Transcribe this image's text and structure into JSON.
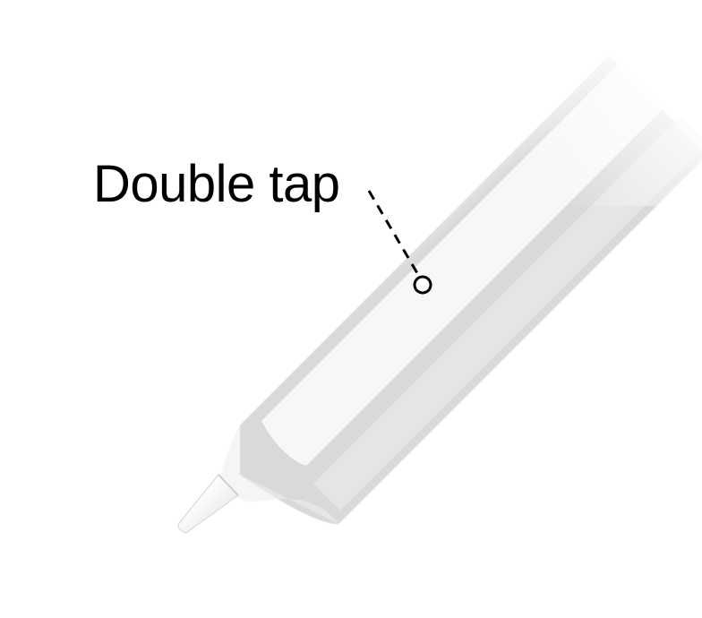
{
  "callout": {
    "label": "Double tap"
  },
  "colors": {
    "background": "#ffffff",
    "pencil_body": "#f2f2f2",
    "pencil_shadow": "#dcdcdc",
    "callout_line": "#000000",
    "label_text": "#000000"
  },
  "icons": {
    "device": "pencil-icon",
    "tap_point": "tap-target-icon"
  }
}
